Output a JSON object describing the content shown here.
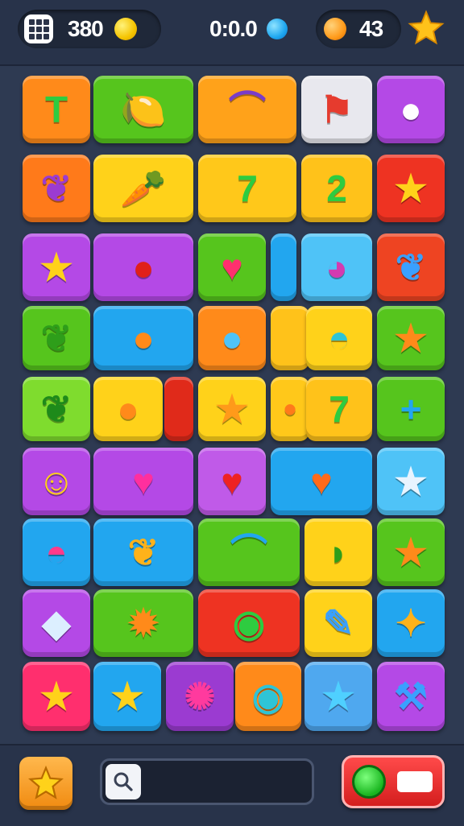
{
  "hud": {
    "grid_button_icon": "grid-icon",
    "score": "380",
    "score_coin_icon": "yellow-coin-icon",
    "time": "0:0.0",
    "time_coin_icon": "blue-gem-icon",
    "coins": "43",
    "coins_icon": "orange-coin-icon",
    "star_icon": "star-icon"
  },
  "colors": {
    "orange": "#ff8a1a",
    "green": "#56c51d",
    "yellow": "#ffd21a",
    "purple": "#b449e6",
    "red": "#ee3322",
    "blue": "#22a6ef",
    "light_gray": "#e8e8ee",
    "lime": "#7fdc2e"
  },
  "tiles": [
    {
      "name": "tile-letter-t",
      "color": "#ff8a1a",
      "glyph": "T",
      "glyph_color": "#2ecc40",
      "icon": "letter-t-icon"
    },
    {
      "name": "tile-lemon",
      "color": "#56c51d",
      "glyph": "🍋",
      "glyph_color": "#ffd21a",
      "icon": "lemon-icon"
    },
    {
      "name": "tile-purple-worm",
      "color": "#ffa21a",
      "glyph": "⌒",
      "glyph_color": "#7a3cc8",
      "icon": "worm-icon"
    },
    {
      "name": "tile-flag",
      "color": "#e8e8ee",
      "glyph": "⚑",
      "glyph_color": "#e63b2e",
      "icon": "flag-icon"
    },
    {
      "name": "tile-cookie",
      "color": "#b449e6",
      "glyph": "●",
      "glyph_color": "#ffffff",
      "icon": "cookie-icon"
    },
    {
      "name": "tile-leaf-purple",
      "color": "#ff7a1a",
      "glyph": "❦",
      "glyph_color": "#9b3bd1",
      "icon": "leaf-icon"
    },
    {
      "name": "tile-carrot",
      "color": "#ffd21a",
      "glyph": "🥕",
      "glyph_color": "#e8521a",
      "icon": "carrot-icon"
    },
    {
      "name": "tile-seven-cherry",
      "color": "#ffc81a",
      "glyph": "7",
      "glyph_color": "#2ecc40",
      "icon": "seven-icon"
    },
    {
      "name": "tile-two",
      "color": "#ffc21a",
      "glyph": "2",
      "glyph_color": "#2ecc40",
      "icon": "two-icon"
    },
    {
      "name": "tile-star-red",
      "color": "#ee3322",
      "glyph": "★",
      "glyph_color": "#ffd21a",
      "icon": "star-icon"
    },
    {
      "name": "tile-star-purple",
      "color": "#b449e6",
      "glyph": "★",
      "glyph_color": "#ffd21a",
      "icon": "star-icon"
    },
    {
      "name": "tile-tomato",
      "color": "#b449e6",
      "glyph": "●",
      "glyph_color": "#e0201a",
      "icon": "tomato-icon"
    },
    {
      "name": "tile-heart-green",
      "color": "#56c51d",
      "glyph": "♥",
      "glyph_color": "#ff2f6e",
      "icon": "heart-icon"
    },
    {
      "name": "tile-blue-bar",
      "color": "#22a6ef",
      "glyph": "",
      "glyph_color": "#ffffff",
      "icon": "blank-icon"
    },
    {
      "name": "tile-creature",
      "color": "#4fc3f7",
      "glyph": "◕",
      "glyph_color": "#d43ab0",
      "icon": "creature-icon"
    },
    {
      "name": "tile-blue-leaf",
      "color": "#ee4422",
      "glyph": "❦",
      "glyph_color": "#3aa0ff",
      "icon": "leaf-icon"
    },
    {
      "name": "tile-leaf-green",
      "color": "#56c51d",
      "glyph": "❦",
      "glyph_color": "#2e9e1a",
      "icon": "leaf-icon"
    },
    {
      "name": "tile-orange-blob",
      "color": "#22a6ef",
      "glyph": "●",
      "glyph_color": "#ff8a1a",
      "icon": "blob-icon"
    },
    {
      "name": "tile-blue-blob",
      "color": "#ff8a1a",
      "glyph": "●",
      "glyph_color": "#4fc3f7",
      "icon": "blob-icon"
    },
    {
      "name": "tile-yellow-plain",
      "color": "#ffc21a",
      "glyph": "",
      "glyph_color": "#ffffff",
      "icon": "blank-icon"
    },
    {
      "name": "tile-robot",
      "color": "#ffd21a",
      "glyph": "◓",
      "glyph_color": "#2ec4d6",
      "icon": "robot-icon"
    },
    {
      "name": "tile-orange-star",
      "color": "#56c51d",
      "glyph": "★",
      "glyph_color": "#ff8a1a",
      "icon": "star-icon"
    },
    {
      "name": "tile-pepper",
      "color": "#7fdc2e",
      "glyph": "❦",
      "glyph_color": "#1e8a1a",
      "icon": "pepper-icon"
    },
    {
      "name": "tile-cracker",
      "color": "#ffd21a",
      "glyph": "●",
      "glyph_color": "#ff8a1a",
      "icon": "cracker-icon"
    },
    {
      "name": "tile-red-bar",
      "color": "#e02a1a",
      "glyph": "",
      "glyph_color": "#ffffff",
      "icon": "blank-icon"
    },
    {
      "name": "tile-star-yellow",
      "color": "#ffd21a",
      "glyph": "★",
      "glyph_color": "#ff9a1a",
      "icon": "star-icon"
    },
    {
      "name": "tile-seed",
      "color": "#ffc81a",
      "glyph": "•",
      "glyph_color": "#ff7a1a",
      "icon": "seed-icon"
    },
    {
      "name": "tile-seven-green",
      "color": "#ffc21a",
      "glyph": "7",
      "glyph_color": "#2ecc40",
      "icon": "seven-icon"
    },
    {
      "name": "tile-plus",
      "color": "#56c51d",
      "glyph": "+",
      "glyph_color": "#22a6ef",
      "icon": "plus-icon"
    },
    {
      "name": "tile-smiley",
      "color": "#b449e6",
      "glyph": "☺",
      "glyph_color": "#ffd21a",
      "icon": "smiley-icon"
    },
    {
      "name": "tile-heart-purple",
      "color": "#b449e6",
      "glyph": "♥",
      "glyph_color": "#ff2f9e",
      "icon": "heart-icon"
    },
    {
      "name": "tile-heart-red",
      "color": "#c05ae8",
      "glyph": "♥",
      "glyph_color": "#ee2222",
      "icon": "heart-icon"
    },
    {
      "name": "tile-blue-heart",
      "color": "#22a6ef",
      "glyph": "♥",
      "glyph_color": "#ff6a1a",
      "icon": "heart-icon"
    },
    {
      "name": "tile-white-star",
      "color": "#4fc3f7",
      "glyph": "★",
      "glyph_color": "#e8f4ff",
      "icon": "star-icon"
    },
    {
      "name": "tile-pink-blob",
      "color": "#22a6ef",
      "glyph": "◓",
      "glyph_color": "#ff3a8a",
      "icon": "blob-icon"
    },
    {
      "name": "tile-fish",
      "color": "#22a6ef",
      "glyph": "❦",
      "glyph_color": "#ffb21a",
      "icon": "fish-icon"
    },
    {
      "name": "tile-worm-blue",
      "color": "#56c51d",
      "glyph": "⌒",
      "glyph_color": "#22a6ef",
      "icon": "worm-icon"
    },
    {
      "name": "tile-cucumber",
      "color": "#ffd21a",
      "glyph": "◗",
      "glyph_color": "#2e9e1a",
      "icon": "cucumber-icon"
    },
    {
      "name": "tile-orange-star-2",
      "color": "#56c51d",
      "glyph": "★",
      "glyph_color": "#ff8a1a",
      "icon": "star-icon"
    },
    {
      "name": "tile-gem",
      "color": "#b449e6",
      "glyph": "◆",
      "glyph_color": "#dcefff",
      "icon": "gem-icon"
    },
    {
      "name": "tile-sun-heart",
      "color": "#56c51d",
      "glyph": "✹",
      "glyph_color": "#ff8a1a",
      "icon": "sun-icon"
    },
    {
      "name": "tile-green-ring",
      "color": "#ee3322",
      "glyph": "◉",
      "glyph_color": "#2ecc40",
      "icon": "ring-icon"
    },
    {
      "name": "tile-pen",
      "color": "#ffd21a",
      "glyph": "✎",
      "glyph_color": "#3aa0ff",
      "icon": "pen-icon"
    },
    {
      "name": "tile-ornament",
      "color": "#22a6ef",
      "glyph": "✦",
      "glyph_color": "#ffb21a",
      "icon": "ornament-icon"
    },
    {
      "name": "tile-star-pink",
      "color": "#ff2f6e",
      "glyph": "★",
      "glyph_color": "#ffd21a",
      "icon": "star-icon"
    },
    {
      "name": "tile-yellow-star-blue",
      "color": "#22a6ef",
      "glyph": "★",
      "glyph_color": "#ffd21a",
      "icon": "star-icon"
    },
    {
      "name": "tile-emblem",
      "color": "#9b3bd1",
      "glyph": "✺",
      "glyph_color": "#ff3a9e",
      "icon": "emblem-icon"
    },
    {
      "name": "tile-drop",
      "color": "#ff8a1a",
      "glyph": "◉",
      "glyph_color": "#2ec4d6",
      "icon": "drop-icon"
    },
    {
      "name": "tile-blue-star",
      "color": "#4fa8ef",
      "glyph": "★",
      "glyph_color": "#4fd0ff",
      "icon": "star-icon"
    },
    {
      "name": "tile-axe",
      "color": "#b449e6",
      "glyph": "⚒",
      "glyph_color": "#3aa0ff",
      "icon": "axe-icon"
    }
  ],
  "footer": {
    "star_button_icon": "star-icon",
    "search_icon": "search-icon",
    "search_value": "",
    "action_button_icon": "green-circle-icon"
  }
}
